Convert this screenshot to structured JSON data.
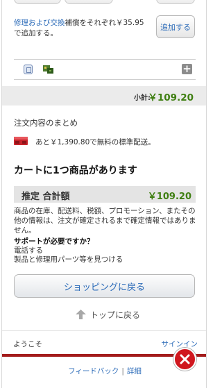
{
  "repair": {
    "link_text": "修理および交換",
    "text_after": "補償をそれぞれ￥35.95で追加する。",
    "add_button": "追加する"
  },
  "subtotal": {
    "label": "小計:",
    "value": "￥109.20"
  },
  "summary": {
    "title": "注文内容のまとめ",
    "shipping_message": "あと￥1,390.80で無料の標準配送。"
  },
  "cart": {
    "count_text": "カートに1つ商品があります"
  },
  "estimate": {
    "label": "推定 合計額",
    "value": "￥109.20"
  },
  "disclaimer": "商品の在庫、配送料、税額、プロモーション、またその他の情報は、注文が確定されるまで確定情報ではありません。",
  "support": {
    "title": "サポートが必要ですか？",
    "phone": "電話する",
    "parts": "製品と修理用パーツ等を見つける"
  },
  "buttons": {
    "continue_shopping": "ショッピングに戻る",
    "back_to_top": "トップに戻る"
  },
  "account": {
    "welcome": "ようこそ",
    "signin": "サインイン"
  },
  "footer": {
    "feedback": "フィードバック",
    "separator": "|",
    "details": "詳細"
  },
  "colors": {
    "price_green": "#3f7f12",
    "link_blue": "#2a6ab8",
    "brand_red": "#a31c1c",
    "close_red": "#d0171e"
  },
  "icons": [
    "bin-icon",
    "gift-tree-icon",
    "expand-plus-icon",
    "shipping-truck-icon",
    "up-arrow-icon",
    "close-icon"
  ]
}
